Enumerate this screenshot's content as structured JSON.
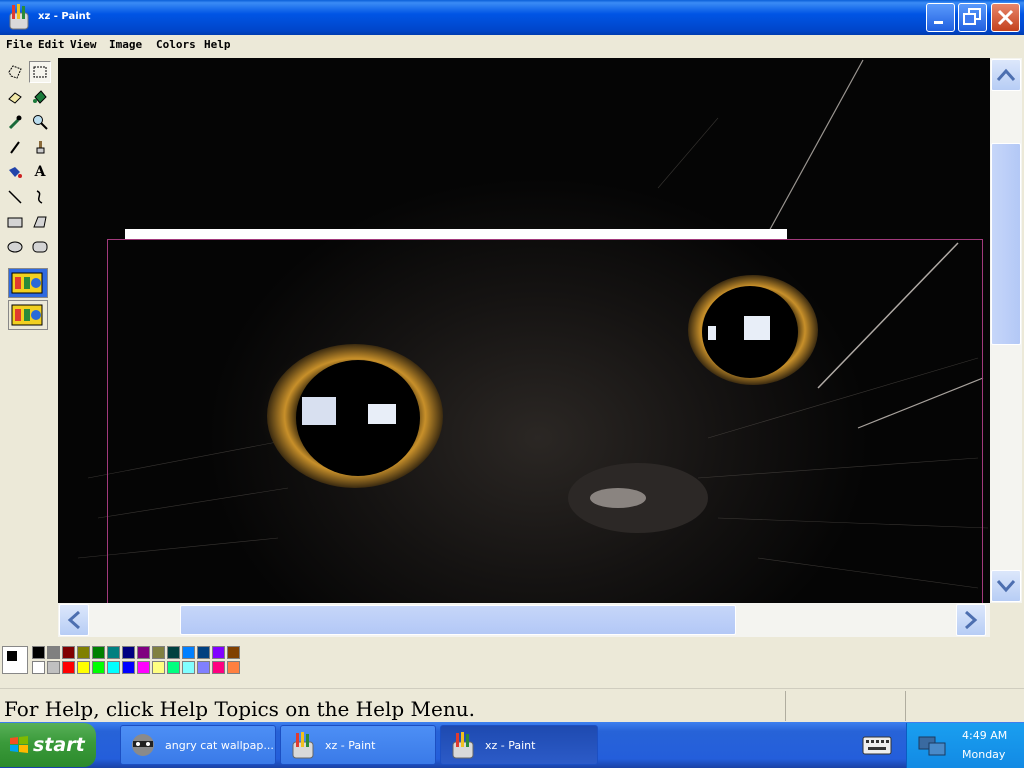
{
  "window": {
    "title": "xz - Paint"
  },
  "menu": [
    "File",
    "Edit",
    "View",
    "Image",
    "Colors",
    "Help"
  ],
  "tools": [
    {
      "name": "free-form-select-icon"
    },
    {
      "name": "select-icon"
    },
    {
      "name": "eraser-icon"
    },
    {
      "name": "fill-icon"
    },
    {
      "name": "pick-color-icon"
    },
    {
      "name": "magnifier-icon"
    },
    {
      "name": "pencil-icon"
    },
    {
      "name": "brush-icon"
    },
    {
      "name": "airbrush-icon"
    },
    {
      "name": "text-icon",
      "glyph": "A"
    },
    {
      "name": "line-icon"
    },
    {
      "name": "curve-icon"
    },
    {
      "name": "rectangle-icon"
    },
    {
      "name": "polygon-icon"
    },
    {
      "name": "ellipse-icon"
    },
    {
      "name": "rounded-rectangle-icon"
    }
  ],
  "palette": {
    "row1": [
      "#000000",
      "#808080",
      "#800000",
      "#808000",
      "#008000",
      "#008080",
      "#000080",
      "#800080",
      "#808040",
      "#004040",
      "#0080ff",
      "#004080",
      "#8000ff",
      "#804000"
    ],
    "row2": [
      "#ffffff",
      "#c0c0c0",
      "#ff0000",
      "#ffff00",
      "#00ff00",
      "#00ffff",
      "#0000ff",
      "#ff00ff",
      "#ffff80",
      "#00ff80",
      "#80ffff",
      "#8080ff",
      "#ff0080",
      "#ff8040"
    ],
    "foreground": "#000000",
    "background": "#ffffff"
  },
  "status": {
    "text": "For Help, click Help Topics on the Help Menu."
  },
  "taskbar": {
    "start_label": "start",
    "items": [
      {
        "label": "angry cat wallpap...",
        "icon": "raccoon-icon",
        "active": false
      },
      {
        "label": "xz - Paint",
        "icon": "paint-icon",
        "active": false
      },
      {
        "label": "xz - Paint",
        "icon": "paint-icon",
        "active": true
      }
    ],
    "clock": {
      "time": "4:49 AM",
      "day": "Monday"
    }
  },
  "colors": {
    "title_bar": "#0055e5",
    "selection_border": "#a23a7c",
    "taskbar": "#245edb",
    "start_button": "#3a9a3a"
  }
}
